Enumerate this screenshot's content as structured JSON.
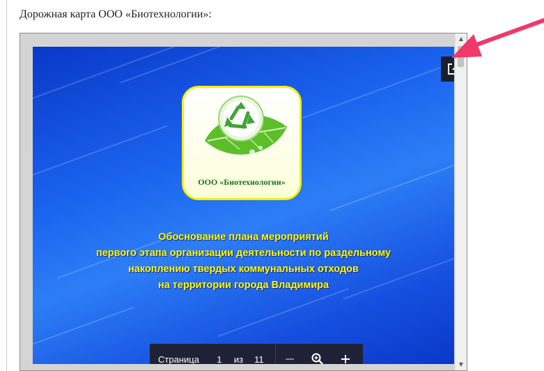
{
  "page": {
    "heading": "Дорожная карта ООО «Биотехнологии»:"
  },
  "slide": {
    "logo_caption": "ООО «Биотехнологии»",
    "title_lines": [
      "Обоснование плана мероприятий",
      "первого этапа организации деятельности по раздельному",
      "накоплению твердых коммунальных отходов",
      "на территории города Владимира"
    ]
  },
  "toolbar": {
    "page_label": "Страница",
    "current_page": "1",
    "of_label": "из",
    "total_pages": "11"
  },
  "icons": {
    "expand": "open-in-new-window-icon",
    "zoom_out": "minus-icon",
    "zoom_reset": "magnifier-icon",
    "zoom_in": "plus-icon",
    "scroll_up": "chevron-up-icon",
    "scroll_down": "chevron-down-icon"
  },
  "colors": {
    "slide_blue": "#1a63ee",
    "title_yellow": "#fff900",
    "toolbar_bg": "#1f2237",
    "arrow_pink": "#f0386b"
  }
}
